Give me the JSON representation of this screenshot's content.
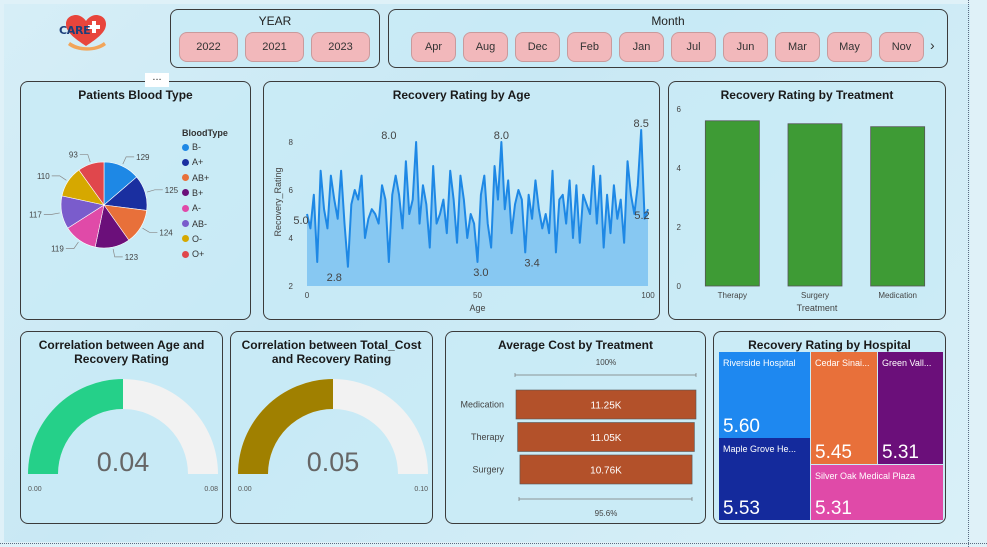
{
  "logo": {
    "text": "CARE",
    "icon": "heart-plus-icon",
    "colors": {
      "heart": "#e8453c",
      "hand": "#f2a55a",
      "text": "#1d3f7a"
    }
  },
  "more_options": {
    "label": "..."
  },
  "year_slicer": {
    "title": "YEAR",
    "items": [
      "2022",
      "2021",
      "2023"
    ]
  },
  "month_slicer": {
    "title": "Month",
    "items": [
      "Apr",
      "Aug",
      "Dec",
      "Feb",
      "Jan",
      "Jul",
      "Jun",
      "Mar",
      "May",
      "Nov"
    ],
    "next_icon": "chevron-right-icon"
  },
  "colors": {
    "pill": "#f2b8bb",
    "area": "#7fc4f2",
    "line": "#1e88e5",
    "bar_green": "#3e9b35",
    "bar_orange": "#b3512a",
    "gauge_green": "#25d089",
    "gauge_gold": "#a08000",
    "gauge_bg": "#f2f2f2"
  },
  "chart_data": [
    {
      "id": "blood_type",
      "type": "pie",
      "title": "Patients Blood Type",
      "legend_title": "BloodType",
      "legend_position": "right",
      "categories": [
        "B-",
        "A+",
        "AB+",
        "B+",
        "A-",
        "AB-",
        "O-",
        "O+"
      ],
      "values": [
        129,
        125,
        124,
        123,
        119,
        117,
        110,
        93
      ],
      "colors": [
        "#1e88e5",
        "#1a2fa0",
        "#e8703a",
        "#6b0f7a",
        "#e04aa8",
        "#7a5ccc",
        "#d6a800",
        "#e0474c"
      ]
    },
    {
      "id": "recovery_by_age",
      "type": "area",
      "title": "Recovery Rating by Age",
      "xlabel": "Age",
      "ylabel": "Recovery_Rating",
      "xlim": [
        0,
        100
      ],
      "ylim": [
        2,
        9
      ],
      "xticks": [
        "0",
        "50",
        "100"
      ],
      "yticks": [
        "2",
        "4",
        "6",
        "8"
      ],
      "y": [
        5.0,
        4.4,
        5.8,
        3.0,
        6.8,
        5.2,
        4.4,
        6.6,
        5.6,
        4.8,
        6.8,
        4.6,
        2.8,
        5.4,
        6.0,
        5.6,
        6.6,
        4.0,
        4.8,
        5.2,
        5.0,
        4.6,
        6.2,
        5.6,
        3.0,
        5.8,
        6.6,
        5.8,
        4.4,
        7.2,
        5.0,
        5.6,
        8.0,
        4.6,
        6.2,
        5.4,
        3.6,
        7.0,
        4.6,
        5.0,
        5.6,
        4.2,
        6.8,
        5.6,
        3.8,
        6.6,
        5.6,
        4.0,
        5.0,
        4.6,
        3.0,
        5.8,
        6.6,
        4.6,
        3.6,
        7.0,
        5.6,
        8.0,
        5.2,
        6.4,
        4.2,
        5.4,
        6.0,
        5.6,
        3.4,
        5.8,
        4.8,
        6.4,
        5.2,
        4.4,
        5.0,
        4.2,
        6.8,
        3.4,
        5.6,
        5.8,
        4.6,
        6.4,
        4.0,
        6.2,
        3.8,
        5.8,
        5.4,
        5.0,
        7.0,
        4.6,
        6.6,
        3.6,
        5.8,
        4.2,
        6.2,
        4.8,
        5.6,
        3.8,
        7.2,
        5.8,
        5.0,
        6.2,
        8.5,
        4.8,
        5.2
      ],
      "annotations": [
        {
          "x": 0,
          "y": 5.0,
          "label": "5.0"
        },
        {
          "x": 8,
          "y": 2.8,
          "label": "2.8"
        },
        {
          "x": 24,
          "y": 8.0,
          "label": "8.0"
        },
        {
          "x": 51,
          "y": 3.0,
          "label": "3.0"
        },
        {
          "x": 57,
          "y": 8.0,
          "label": "8.0"
        },
        {
          "x": 66,
          "y": 3.4,
          "label": "3.4"
        },
        {
          "x": 98,
          "y": 8.5,
          "label": "8.5"
        },
        {
          "x": 100,
          "y": 5.2,
          "label": "5.2"
        }
      ]
    },
    {
      "id": "recovery_by_treatment",
      "type": "bar",
      "title": "Recovery Rating by Treatment",
      "xlabel": "Treatment",
      "ylabel": "",
      "categories": [
        "Therapy",
        "Surgery",
        "Medication"
      ],
      "values": [
        5.6,
        5.5,
        5.4
      ],
      "ylim": [
        0,
        6
      ],
      "yticks": [
        "0",
        "2",
        "4",
        "6"
      ]
    },
    {
      "id": "corr_age",
      "type": "gauge",
      "title": "Correlation between Age and Recovery Rating",
      "value": 0.04,
      "value_label": "0.04",
      "min_label": "0.00",
      "max_label": "0.08",
      "min": 0,
      "max": 0.08
    },
    {
      "id": "corr_cost",
      "type": "gauge",
      "title": "Correlation between Total_Cost and Recovery Rating",
      "value": 0.05,
      "value_label": "0.05",
      "min_label": "0.00",
      "max_label": "0.10",
      "min": 0,
      "max": 0.1
    },
    {
      "id": "avg_cost",
      "type": "funnel",
      "title": "Average Cost by Treatment",
      "categories": [
        "Medication",
        "Therapy",
        "Surgery"
      ],
      "values": [
        11.25,
        11.05,
        10.76
      ],
      "labels": [
        "11.25K",
        "11.05K",
        "10.76K"
      ],
      "top_percent": "100%",
      "bottom_percent": "95.6%"
    },
    {
      "id": "recovery_by_hospital",
      "type": "treemap",
      "title": "Recovery Rating by Hospital",
      "tiles": [
        {
          "name": "Riverside Hospital",
          "value": "5.60",
          "color": "#1e88f0"
        },
        {
          "name": "Maple Grove He...",
          "value": "5.53",
          "color": "#142a9c"
        },
        {
          "name": "Cedar Sinai...",
          "value": "5.45",
          "color": "#e8703a"
        },
        {
          "name": "Green Vall...",
          "value": "5.31",
          "color": "#6b0f7a"
        },
        {
          "name": "Silver Oak Medical Plaza",
          "value": "5.31",
          "color": "#e04aa8"
        }
      ]
    }
  ]
}
